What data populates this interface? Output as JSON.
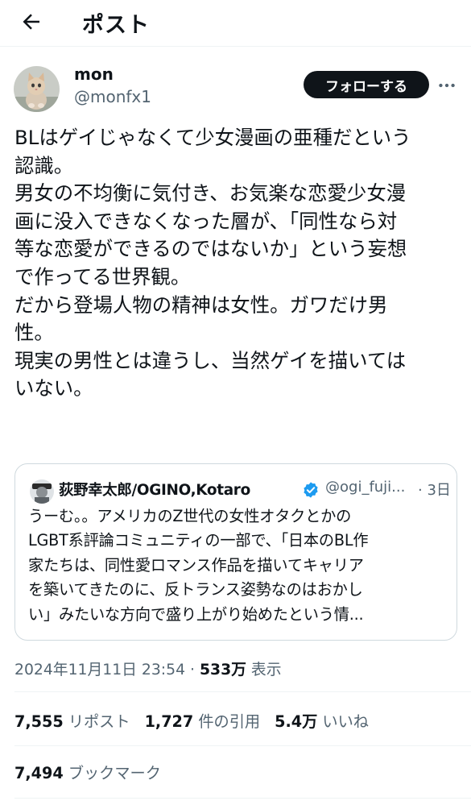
{
  "header": {
    "title": "ポスト",
    "back_icon": "back-arrow-icon"
  },
  "author": {
    "display_name": "mon",
    "handle": "@monfx1",
    "avatar_icon": "cat-avatar-icon",
    "follow_label": "フォローする",
    "more_icon": "more-options-icon"
  },
  "post": {
    "text": "BLはゲイじゃなくて少女漫画の亜種だという\n認識。\n男女の不均衡に気付き、お気楽な恋愛少女漫\n画に没入できなくなった層が、「同性なら対\n等な恋愛ができるのではないか」という妄想\nで作ってる世界観。\nだから登場人物の精神は女性。ガワだけ男\n性。\n現実の男性とは違うし、当然ゲイを描いては\nいない。"
  },
  "quote": {
    "name": "荻野幸太郎/OGINO,Kotaro",
    "verified_icon": "verified-badge-icon",
    "handle": "@ogi_fuji...",
    "date": "· 3日",
    "text": "うーむ。。アメリカのZ世代の女性オタクとかの\nLGBT系評論コミュニティの一部で、「日本のBL作\n家たちは、同性愛ロマンス作品を描いてキャリア\nを築いてきたのに、反トランス姿勢なのはおかし\nい」みたいな方向で盛り上がり始めたという情..."
  },
  "meta": {
    "timestamp": "2024年11月11日 23:54 · ",
    "views": "533万",
    "views_label": " 表示"
  },
  "stats": {
    "reposts": "7,555",
    "reposts_label": "リポスト",
    "quotes": "1,727",
    "quotes_label": "件の引用",
    "likes": "5.4万",
    "likes_label": "いいね",
    "bookmarks": "7,494",
    "bookmarks_label": "ブックマーク"
  },
  "colors": {
    "text": "#0f1419",
    "secondary": "#536471",
    "verified": "#1d9bf0",
    "border": "#cfd9de"
  }
}
